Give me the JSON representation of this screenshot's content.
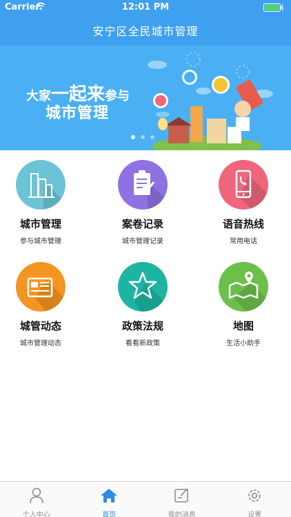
{
  "status": {
    "carrier": "Carrier",
    "time": "12:01 PM"
  },
  "nav": {
    "title": "安宁区全民城市管理"
  },
  "banner": {
    "line1_a": "大家",
    "line1_big": "一起来",
    "line1_b": "参与",
    "line2": "城市管理"
  },
  "grid": [
    {
      "title": "城市管理",
      "subtitle": "参与城市管理",
      "color": "#6bc4d6",
      "icon": "city-buildings-icon"
    },
    {
      "title": "案卷记录",
      "subtitle": "城市管理记录",
      "color": "#8e71e2",
      "icon": "clipboard-edit-icon"
    },
    {
      "title": "语音热线",
      "subtitle": "常用电话",
      "color": "#f0667b",
      "icon": "phone-call-icon"
    },
    {
      "title": "城管动态",
      "subtitle": "城市管理动态",
      "color": "#f39521",
      "icon": "news-icon"
    },
    {
      "title": "政策法规",
      "subtitle": "看看新政策",
      "color": "#1db5a2",
      "icon": "star-icon"
    },
    {
      "title": "地图",
      "subtitle": "生活小助手",
      "color": "#6cc04a",
      "icon": "map-pin-icon"
    }
  ],
  "tabs": [
    {
      "label": "个人中心",
      "icon": "user-icon",
      "active": false
    },
    {
      "label": "首页",
      "icon": "home-icon",
      "active": true
    },
    {
      "label": "我的消息",
      "icon": "message-edit-icon",
      "active": false
    },
    {
      "label": "设置",
      "icon": "gear-icon",
      "active": false
    }
  ],
  "colors": {
    "nav_blue": "#3ea0ef",
    "banner_blue": "#4ab0f3",
    "tab_active": "#2d8ae6",
    "tab_inactive": "#8e8e8e"
  }
}
